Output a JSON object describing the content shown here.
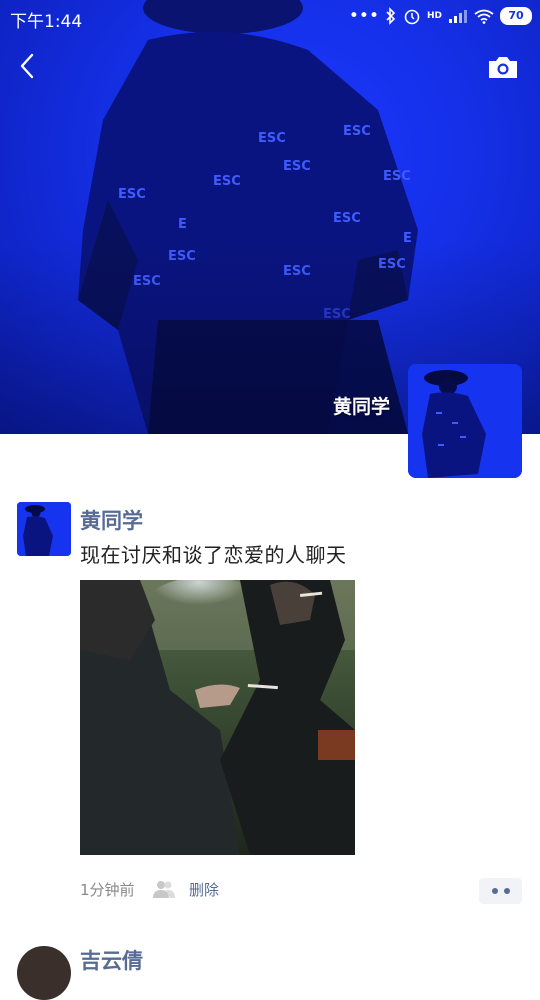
{
  "status_bar": {
    "time": "下午1:44",
    "network_badge": "HD",
    "battery": "70"
  },
  "header": {
    "back_icon": "chevron-left-icon",
    "camera_icon": "camera-icon"
  },
  "cover": {
    "cover_text": [
      "ESC"
    ],
    "user_name": "黄同学"
  },
  "posts": [
    {
      "author": "黄同学",
      "text": "现在讨厌和谈了恋爱的人聊天",
      "time": "1分钟前",
      "delete_label": "删除",
      "visibility_icon": "friends-icon",
      "more_icon": "more-dots-icon"
    },
    {
      "author": "吉云倩"
    }
  ],
  "colors": {
    "cover_blue": "#1530e8",
    "link_blue": "#576b95",
    "text": "#222222",
    "meta_gray": "#8a8a8a"
  }
}
